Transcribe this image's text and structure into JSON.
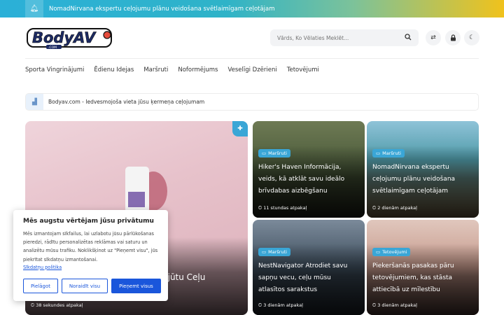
{
  "ticker": {
    "text": "NomadNirvana ekspertu ceļojumu plānu veidošana svētlaimīgam ceļotājam"
  },
  "header": {
    "logo_text": "BodyAV",
    "logo_sub": ".COM",
    "search_placeholder": "Vārds, Ko Vēlaties Meklēt..."
  },
  "nav": [
    "Sporta Vingrinājumi",
    "Ēdienu Idejas",
    "Maršruti",
    "Noformējums",
    "Veselīgi Dzērieni",
    "Tetovējumi"
  ],
  "notice": {
    "text": "Bodyav.com - Iedvesmojoša vieta jūsu ķermeņa ceļojumam"
  },
  "featured": {
    "title": "sajūtu Ceļu",
    "time": "38 sekundes atpakaļ"
  },
  "cards": [
    {
      "category": "Maršruti",
      "title": "Hiker's Haven Informācija, veids, kā atklāt savu ideālo brīvdabas aizbēgšanu",
      "time": "11 stundas atpakaļ"
    },
    {
      "category": "Maršruti",
      "title": "NomadNirvana ekspertu ceļojumu plānu veidošana svētlaimīgam ceļotājam",
      "time": "2 dienām atpakaļ"
    },
    {
      "category": "Maršruti",
      "title": "NestNavigator Atrodiet savu sapņu vecu, ceļu mūsu atlasītos sarakstus",
      "time": "3 dienām atpakaļ"
    },
    {
      "category": "Tetovējumi",
      "title": "Piekeršanās pasakas pāru tetovējumiem, kas stāsta attiecībā uz mīlestību",
      "time": "3 dienām atpakaļ"
    }
  ],
  "cookie": {
    "title": "Mēs augstu vērtējam jūsu privātumu",
    "body": "Mēs izmantojam sīkfailus, lai uzlabotu jūsu pārlūkošanas pieredzi, rādītu personalizētas reklāmas vai saturu un analizētu mūsu trafiku. Noklikšķinot uz \"Pieņemt visu\", jūs piekrītat sīkdatņu izmantošanai.",
    "policy_link": "Sīkdatņu politika",
    "btn_customize": "Pielāgot",
    "btn_reject": "Noraidīt visu",
    "btn_accept": "Pieņemt visus"
  },
  "colors": {
    "accent": "#3aa6d6",
    "cookie_button": "#1a56db"
  }
}
